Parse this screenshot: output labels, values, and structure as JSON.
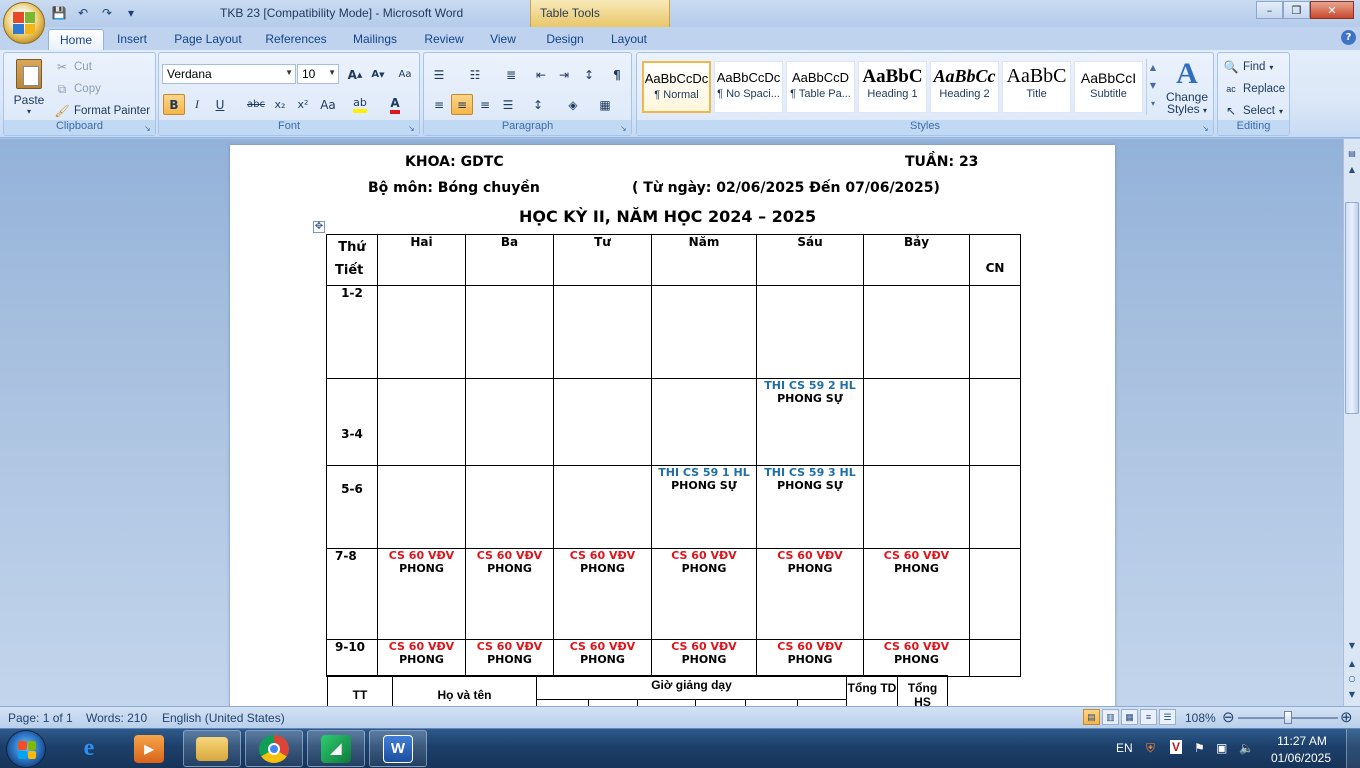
{
  "window": {
    "title": "TKB 23 [Compatibility Mode] - Microsoft Word",
    "contextual_tab": "Table Tools",
    "controls": {
      "minimize": "–",
      "maximize": "❐",
      "close": "✕"
    }
  },
  "ribbon_tabs": [
    "Home",
    "Insert",
    "Page Layout",
    "References",
    "Mailings",
    "Review",
    "View",
    "Design",
    "Layout"
  ],
  "clipboard": {
    "label": "Clipboard",
    "paste": "Paste",
    "cut": "Cut",
    "copy": "Copy",
    "format_painter": "Format Painter"
  },
  "font": {
    "label": "Font",
    "name": "Verdana",
    "size": "10"
  },
  "paragraph": {
    "label": "Paragraph"
  },
  "styles": {
    "label": "Styles",
    "items": [
      {
        "sample": "AaBbCcDc",
        "name": "¶ Normal"
      },
      {
        "sample": "AaBbCcDc",
        "name": "¶ No Spaci..."
      },
      {
        "sample": "AaBbCcD",
        "name": "¶ Table Pa..."
      },
      {
        "sample": "AaBbC",
        "name": "Heading 1"
      },
      {
        "sample": "AaBbCc",
        "name": "Heading 2"
      },
      {
        "sample": "AaBbC",
        "name": "Title"
      },
      {
        "sample": "AaBbCcI",
        "name": "Subtitle"
      }
    ],
    "change_styles_line1": "Change",
    "change_styles_line2": "Styles"
  },
  "editing": {
    "label": "Editing",
    "find": "Find",
    "replace": "Replace",
    "select": "Select"
  },
  "document": {
    "khoa": "KHOA: GDTC",
    "tuan": "TUẦN: 23",
    "bo_mon": "Bộ môn: Bóng chuyền",
    "date_range": "( Từ ngày: 02/06/2025  Đến 07/06/2025)",
    "semester": "HỌC KỲ II, NĂM HỌC 2024 – 2025",
    "header_corner_top": "Thứ",
    "header_corner_bottom": "Tiết",
    "days": [
      "Hai",
      "Ba",
      "Tư",
      "Năm",
      "Sáu",
      "Bảy",
      "CN"
    ],
    "periods": [
      "1-2",
      "3-4",
      "5-6",
      "7-8",
      "9-10"
    ],
    "thi_59_2": "THI CS 59 2 HL",
    "thi_59_1": "THI CS 59 1 HL",
    "thi_59_3": "THI CS 59 3 HL",
    "phong_su": "PHONG SỰ",
    "cs60": "CS 60 VĐV",
    "phong": "PHONG",
    "t2_tt": "TT",
    "t2_name": "Họ và tên",
    "t2_gio": "Giờ giảng dạy",
    "t2_tong_td": "Tổng TD",
    "t2_tong_hs": "Tổng HS"
  },
  "statusbar": {
    "page": "Page: 1 of 1",
    "words": "Words: 210",
    "language": "English (United States)",
    "zoom": "108%"
  },
  "taskbar": {
    "language": "EN",
    "time": "11:27 AM",
    "date": "01/06/2025"
  }
}
